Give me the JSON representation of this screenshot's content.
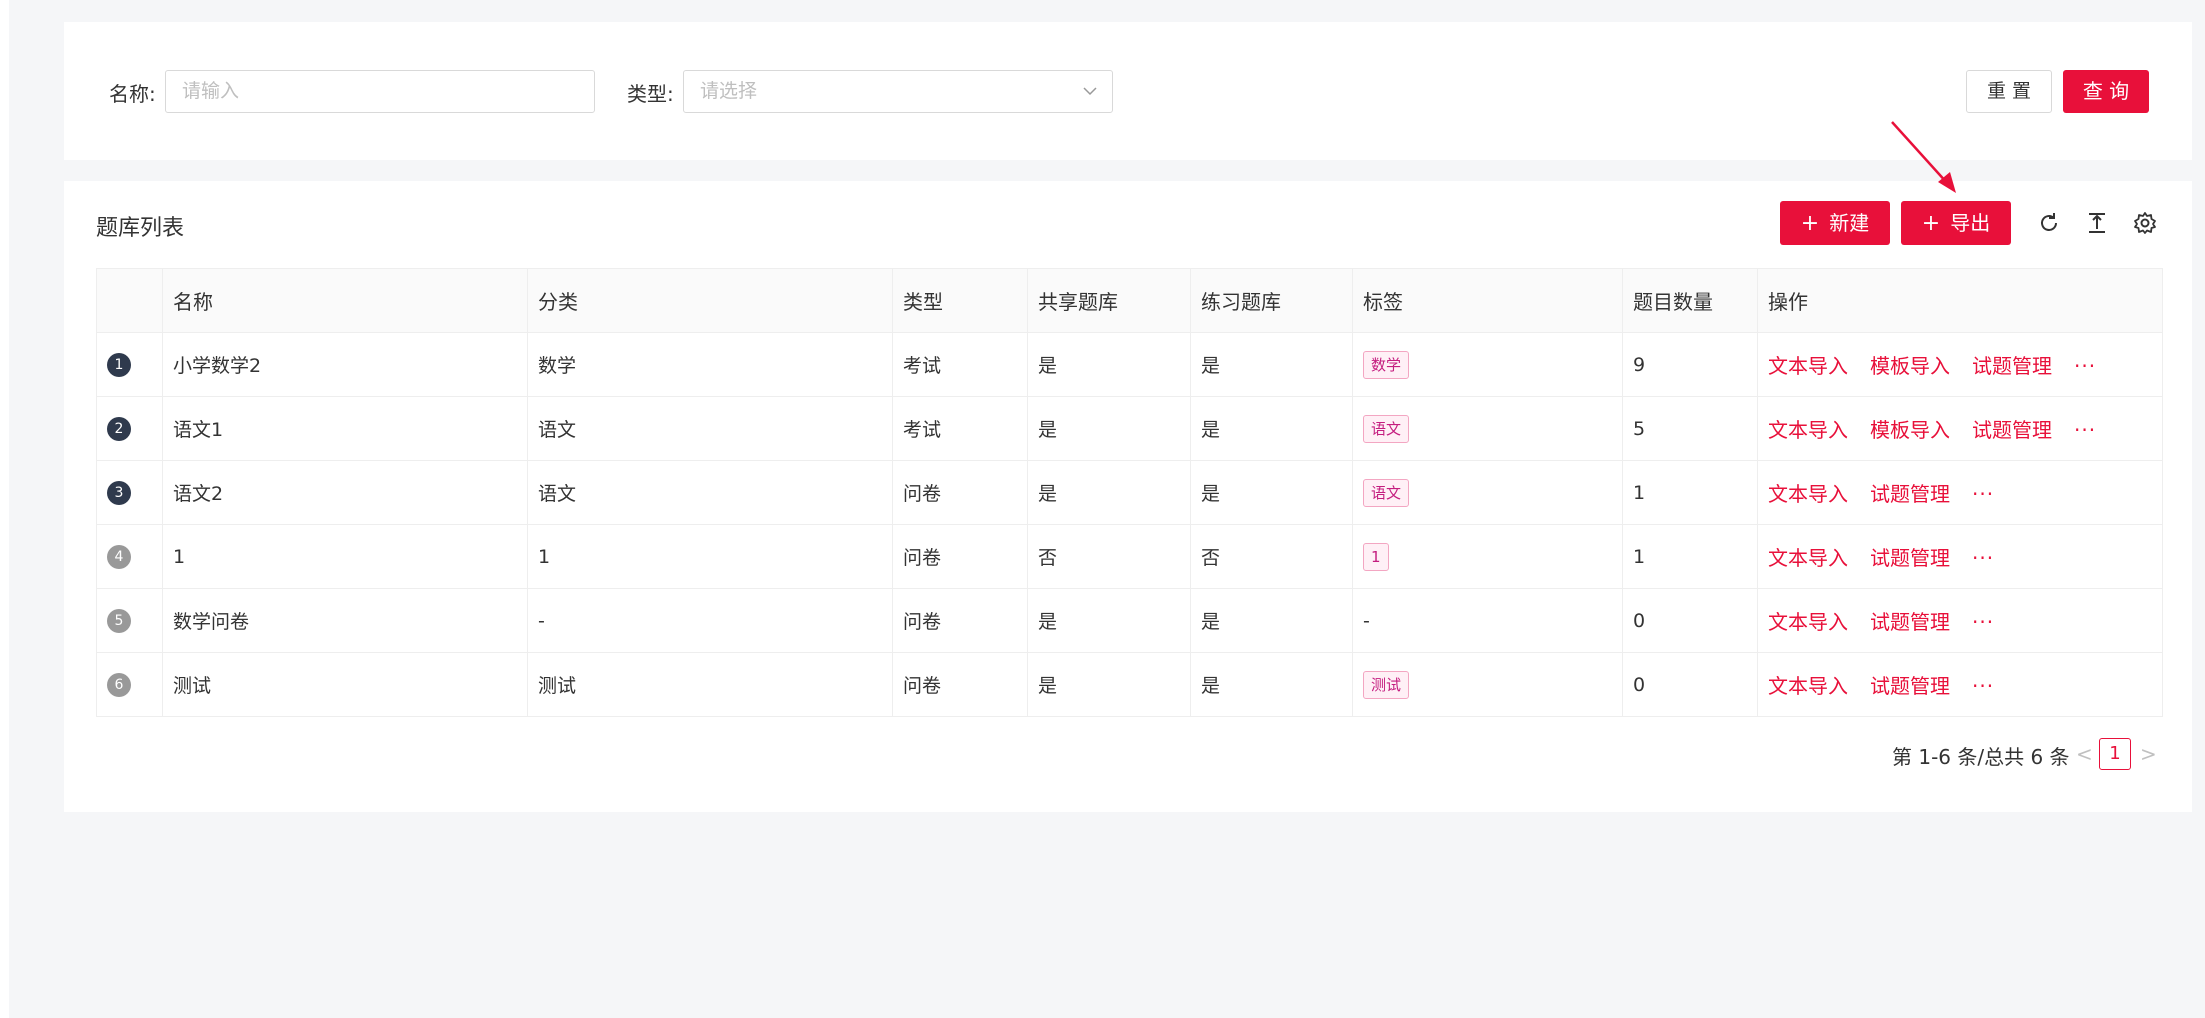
{
  "search": {
    "name_label": "名称:",
    "name_placeholder": "请输入",
    "type_label": "类型:",
    "type_placeholder": "请选择",
    "reset_label": "重 置",
    "query_label": "查 询"
  },
  "list": {
    "title": "题库列表",
    "new_label": "新建",
    "export_label": "导出",
    "columns": [
      "名称",
      "分类",
      "类型",
      "共享题库",
      "练习题库",
      "标签",
      "题目数量",
      "操作"
    ],
    "rows": [
      {
        "index": "1",
        "name": "小学数学2",
        "category": "数学",
        "type": "考试",
        "shared": "是",
        "practice": "是",
        "tag": "数学",
        "count": "9",
        "ops": [
          "文本导入",
          "模板导入",
          "试题管理",
          "···"
        ]
      },
      {
        "index": "2",
        "name": "语文1",
        "category": "语文",
        "type": "考试",
        "shared": "是",
        "practice": "是",
        "tag": "语文",
        "count": "5",
        "ops": [
          "文本导入",
          "模板导入",
          "试题管理",
          "···"
        ]
      },
      {
        "index": "3",
        "name": "语文2",
        "category": "语文",
        "type": "问卷",
        "shared": "是",
        "practice": "是",
        "tag": "语文",
        "count": "1",
        "ops": [
          "文本导入",
          "试题管理",
          "···"
        ]
      },
      {
        "index": "4",
        "name": "1",
        "category": "1",
        "type": "问卷",
        "shared": "否",
        "practice": "否",
        "tag": "1",
        "count": "1",
        "ops": [
          "文本导入",
          "试题管理",
          "···"
        ]
      },
      {
        "index": "5",
        "name": "数学问卷",
        "category": "-",
        "type": "问卷",
        "shared": "是",
        "practice": "是",
        "tag": "-",
        "count": "0",
        "ops": [
          "文本导入",
          "试题管理",
          "···"
        ]
      },
      {
        "index": "6",
        "name": "测试",
        "category": "测试",
        "type": "问卷",
        "shared": "是",
        "practice": "是",
        "tag": "测试",
        "count": "0",
        "ops": [
          "文本导入",
          "试题管理",
          "···"
        ]
      }
    ]
  },
  "pagination": {
    "summary": "第 1-6 条/总共 6 条",
    "prev": "<",
    "current": "1",
    "next": ">"
  },
  "colors": {
    "primary": "#e8103a",
    "tag_text": "#c41d7f",
    "tag_bg": "#fff0f6",
    "index_dark": "#2f3a4d",
    "index_light": "#999999"
  },
  "icons": {
    "toolbar": [
      "reload-icon",
      "column-height-icon",
      "setting-icon"
    ],
    "select": "chevron-down-icon",
    "annotation": "red-arrow-icon"
  }
}
